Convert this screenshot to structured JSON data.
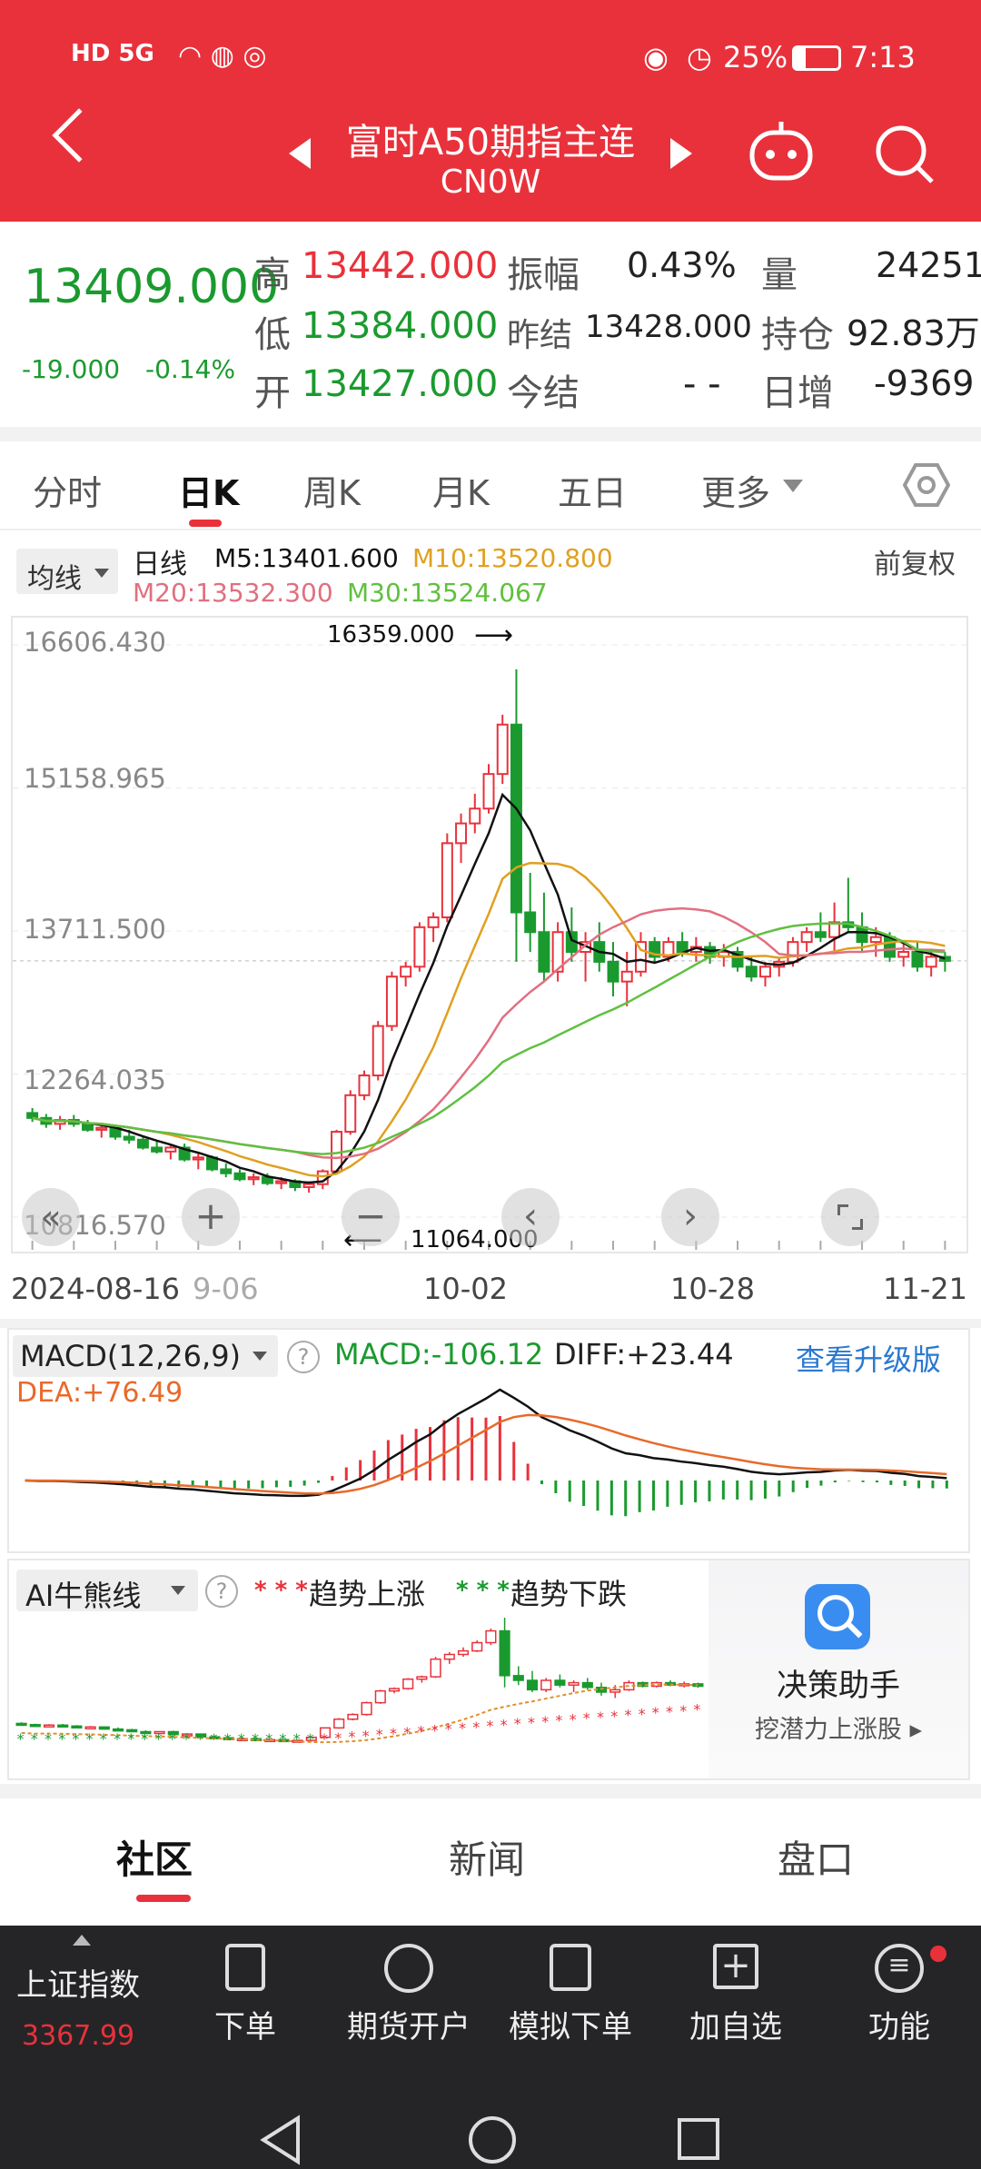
{
  "status_bar": {
    "left": "HD 5G",
    "battery": "25%",
    "time": "7:13"
  },
  "header": {
    "title": "富时A50期指主连",
    "code": "CN0W"
  },
  "quote": {
    "price": "13409.000",
    "change": "-19.000",
    "change_pct": "-0.14%",
    "high_label": "高",
    "high": "13442.000",
    "low_label": "低",
    "low": "13384.000",
    "open_label": "开",
    "open": "13427.000",
    "amp_label": "振幅",
    "amp": "0.43%",
    "prev_label": "昨结",
    "prev": "13428.000",
    "today_label": "今结",
    "today": "- -",
    "vol_label": "量",
    "vol": "24251",
    "oi_label": "持仓",
    "oi": "92.83万",
    "inc_label": "日增",
    "inc": "-9369"
  },
  "tabs": [
    "分时",
    "日K",
    "周K",
    "月K",
    "五日",
    "更多"
  ],
  "kline": {
    "ma_btn": "均线",
    "type_label": "日线",
    "adjust": "前复权",
    "m5": "M5:13401.600",
    "m10": "M10:13520.800",
    "m20": "M20:13532.300",
    "m30": "M30:13524.067",
    "y_ticks": [
      "16606.430",
      "15158.965",
      "13711.500",
      "12264.035",
      "10816.570"
    ],
    "x_ticks": [
      "2024-08-16",
      "9-06",
      "10-02",
      "10-28",
      "11-21"
    ],
    "max_note": "16359.000",
    "min_note": "11064.000"
  },
  "macd": {
    "selector": "MACD(12,26,9)",
    "macd": "MACD:-106.12",
    "diff": "DIFF:+23.44",
    "dea": "DEA:+76.49",
    "upgrade": "查看升级版"
  },
  "ai": {
    "selector": "AI牛熊线",
    "up": "趋势上涨",
    "down": "趋势下跌",
    "up_marks": "* * *",
    "down_marks": "* * *",
    "helper_title": "决策助手",
    "helper_sub": "挖潜力上涨股"
  },
  "sub_tabs": [
    "社区",
    "新闻",
    "盘口"
  ],
  "bottom_nav": {
    "index_name": "上证指数",
    "index_value": "3367.99",
    "items": [
      "下单",
      "期货开户",
      "模拟下单",
      "加自选",
      "功能"
    ]
  },
  "colors": {
    "red": "#e9313b",
    "green": "#1a9a2e",
    "m5": "#111111",
    "m10": "#e0a020",
    "m20": "#e07080",
    "m30": "#60c040"
  },
  "chart_data": {
    "type": "candlestick",
    "x_ticks": [
      "2024-08-16",
      "9-06",
      "10-02",
      "10-28",
      "11-21"
    ],
    "y_ticks": [
      16606.43,
      15158.965,
      13711.5,
      12264.035,
      10816.57
    ],
    "ylim": [
      10816.57,
      16606.43
    ],
    "max": 16359.0,
    "min": 11064.0,
    "ma": {
      "M5": 13401.6,
      "M10": 13520.8,
      "M20": 13532.3,
      "M30": 13524.067
    },
    "candles": [
      [
        11870,
        11920,
        11780,
        11820
      ],
      [
        11820,
        11860,
        11720,
        11760
      ],
      [
        11760,
        11840,
        11700,
        11800
      ],
      [
        11800,
        11850,
        11730,
        11760
      ],
      [
        11760,
        11800,
        11680,
        11700
      ],
      [
        11700,
        11760,
        11620,
        11720
      ],
      [
        11720,
        11740,
        11600,
        11630
      ],
      [
        11630,
        11700,
        11560,
        11600
      ],
      [
        11600,
        11640,
        11500,
        11520
      ],
      [
        11520,
        11580,
        11460,
        11480
      ],
      [
        11480,
        11540,
        11400,
        11520
      ],
      [
        11520,
        11560,
        11380,
        11400
      ],
      [
        11400,
        11460,
        11300,
        11420
      ],
      [
        11420,
        11440,
        11280,
        11300
      ],
      [
        11300,
        11360,
        11220,
        11260
      ],
      [
        11260,
        11300,
        11180,
        11200
      ],
      [
        11200,
        11260,
        11140,
        11220
      ],
      [
        11220,
        11260,
        11140,
        11160
      ],
      [
        11160,
        11220,
        11100,
        11180
      ],
      [
        11180,
        11200,
        11080,
        11120
      ],
      [
        11120,
        11180,
        11064,
        11150
      ],
      [
        11150,
        11300,
        11100,
        11280
      ],
      [
        11280,
        11700,
        11260,
        11680
      ],
      [
        11680,
        12100,
        11650,
        12050
      ],
      [
        12050,
        12300,
        12000,
        12250
      ],
      [
        12250,
        12800,
        12200,
        12750
      ],
      [
        12750,
        13300,
        12700,
        13250
      ],
      [
        13250,
        13400,
        13150,
        13350
      ],
      [
        13350,
        13800,
        13300,
        13750
      ],
      [
        13750,
        13900,
        13600,
        13850
      ],
      [
        13850,
        14700,
        13800,
        14600
      ],
      [
        14600,
        14900,
        14400,
        14800
      ],
      [
        14800,
        15100,
        14700,
        14950
      ],
      [
        14950,
        15400,
        14900,
        15300
      ],
      [
        15300,
        15900,
        15200,
        15800
      ],
      [
        15800,
        16359,
        13400,
        13900
      ],
      [
        13900,
        14300,
        13500,
        13700
      ],
      [
        13700,
        14100,
        13200,
        13300
      ],
      [
        13300,
        13800,
        13200,
        13700
      ],
      [
        13700,
        13950,
        13400,
        13500
      ],
      [
        13500,
        13700,
        13200,
        13600
      ],
      [
        13600,
        13800,
        13300,
        13400
      ],
      [
        13400,
        13600,
        13050,
        13200
      ],
      [
        13200,
        13500,
        12950,
        13300
      ],
      [
        13300,
        13700,
        13250,
        13600
      ],
      [
        13600,
        13650,
        13400,
        13450
      ],
      [
        13450,
        13650,
        13400,
        13600
      ],
      [
        13600,
        13700,
        13450,
        13500
      ],
      [
        13500,
        13650,
        13400,
        13550
      ],
      [
        13550,
        13600,
        13380,
        13450
      ],
      [
        13450,
        13580,
        13350,
        13500
      ],
      [
        13500,
        13550,
        13300,
        13350
      ],
      [
        13350,
        13450,
        13200,
        13250
      ],
      [
        13250,
        13400,
        13150,
        13350
      ],
      [
        13350,
        13450,
        13250,
        13400
      ],
      [
        13400,
        13650,
        13350,
        13600
      ],
      [
        13600,
        13750,
        13500,
        13700
      ],
      [
        13700,
        13900,
        13600,
        13650
      ],
      [
        13650,
        14000,
        13500,
        13800
      ],
      [
        13800,
        14250,
        13700,
        13750
      ],
      [
        13750,
        13900,
        13500,
        13600
      ],
      [
        13600,
        13750,
        13450,
        13650
      ],
      [
        13650,
        13700,
        13400,
        13450
      ],
      [
        13450,
        13600,
        13350,
        13500
      ],
      [
        13500,
        13600,
        13300,
        13350
      ],
      [
        13350,
        13500,
        13250,
        13450
      ],
      [
        13450,
        13500,
        13300,
        13409
      ]
    ],
    "macd": {
      "macd": -106.12,
      "diff": 23.44,
      "dea": 76.49
    }
  }
}
